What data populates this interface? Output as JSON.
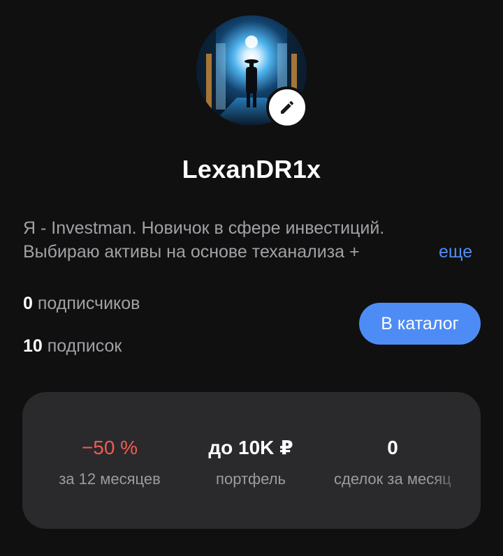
{
  "profile": {
    "username": "LexanDR1x",
    "bio_line1": "Я - Investman. Новичок в сфере инвестиций.",
    "bio_line2": "Выбираю активы на основе теханализа +",
    "more_label": "еще"
  },
  "stats": {
    "subscribers_count": "0",
    "subscribers_label": "подписчиков",
    "subscriptions_count": "10",
    "subscriptions_label": "подписок"
  },
  "actions": {
    "catalog_label": "В каталог"
  },
  "metrics": [
    {
      "value": "−50 %",
      "label": "за 12 месяцев"
    },
    {
      "value": "до 10K ₽",
      "label": "портфель"
    },
    {
      "value": "0",
      "label": "сделок за месяц"
    }
  ],
  "icons": {
    "edit": "pencil-icon"
  },
  "colors": {
    "background": "#101011",
    "accent": "#4e8cf5",
    "negative": "#f25a55",
    "card": "#2a2a2c"
  }
}
